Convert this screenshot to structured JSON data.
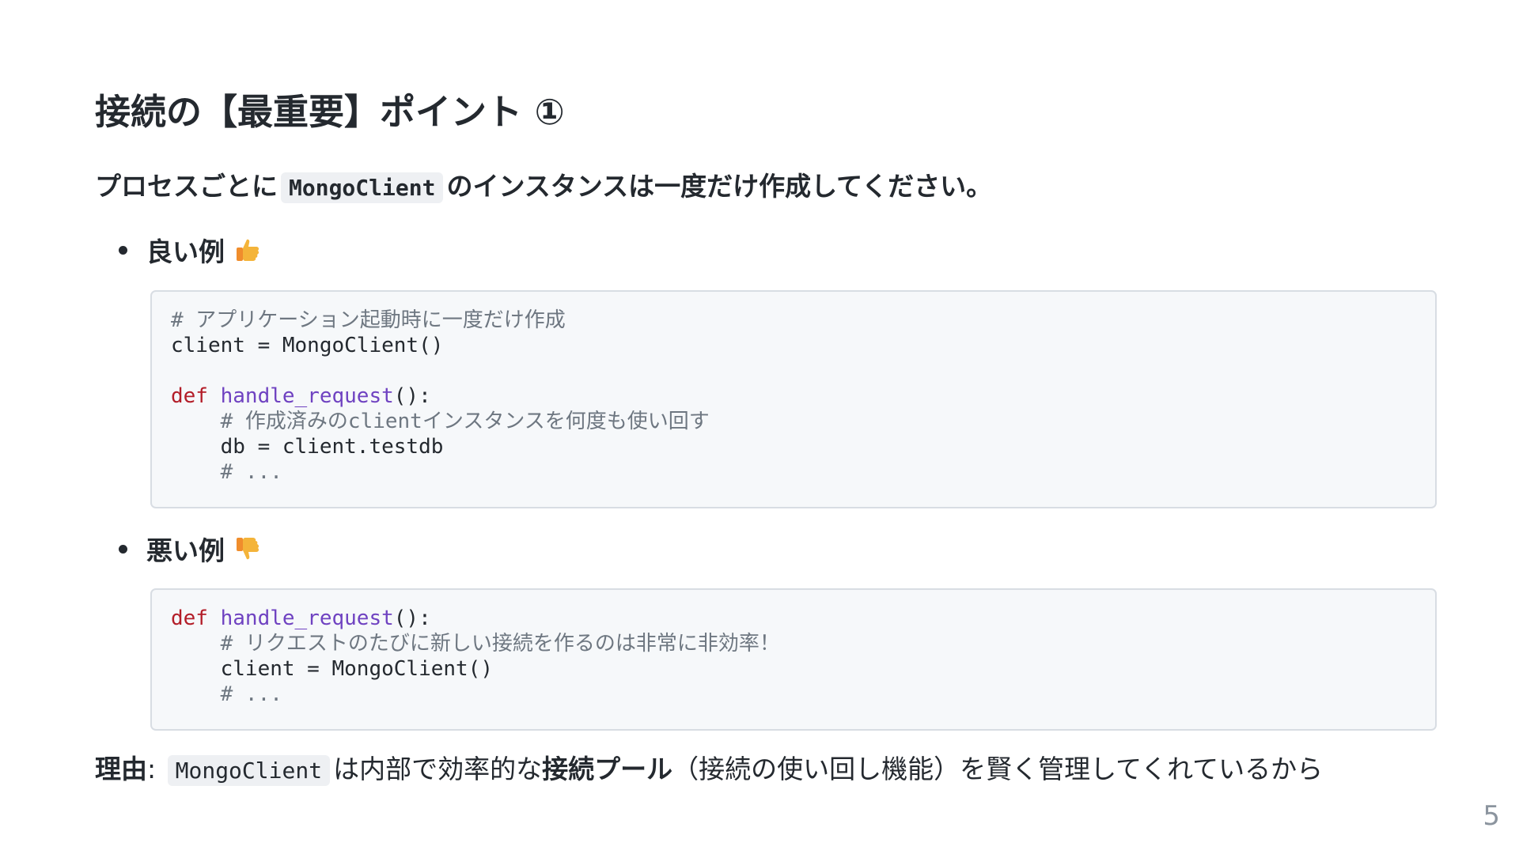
{
  "title": "接続の【最重要】ポイント ①",
  "lead": {
    "prefix": "プロセスごとに",
    "code": "MongoClient",
    "suffix": "のインスタンスは一度だけ作成してください。"
  },
  "good_example": {
    "label": "良い例",
    "icon": "thumbs-up-icon",
    "code": {
      "line1_comment": "# アプリケーション起動時に一度だけ作成",
      "line2": "client = MongoClient()",
      "line4_kw": "def",
      "line4_fn": "handle_request",
      "line4_rest": "():",
      "line5_comment": "    # 作成済みのclientインスタンスを何度も使い回す",
      "line6": "    db = client.testdb",
      "line7_comment": "    # ..."
    }
  },
  "bad_example": {
    "label": "悪い例",
    "icon": "thumbs-down-icon",
    "code": {
      "line1_kw": "def",
      "line1_fn": "handle_request",
      "line1_rest": "():",
      "line2_comment": "    # リクエストのたびに新しい接続を作るのは非常に非効率！",
      "line3": "    client = MongoClient()",
      "line4_comment": "    # ..."
    }
  },
  "reason": {
    "label": "理由",
    "colon": ":",
    "code": "MongoClient",
    "text1": "は内部で効率的な",
    "bold": "接続プール",
    "text2": "（接続の使い回し機能）を賢く管理してくれているから"
  },
  "page_number": "5",
  "colors": {
    "keyword": "#b31d28",
    "function": "#6f42c1",
    "comment": "#6e7781",
    "code_bg": "#f6f8fa",
    "emoji": "#f4b43a"
  }
}
